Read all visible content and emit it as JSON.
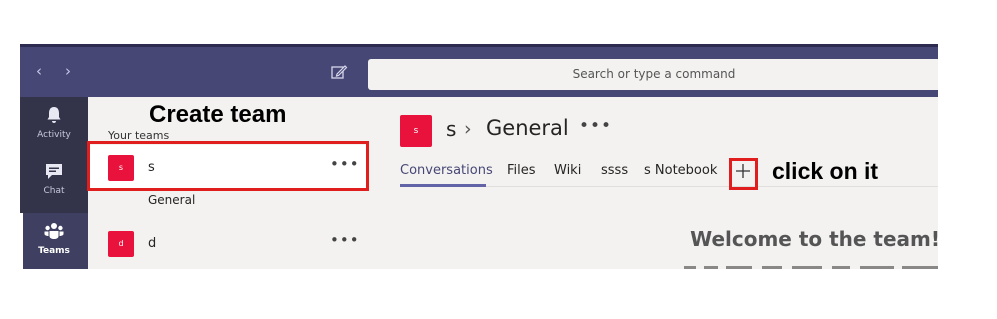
{
  "topbar": {
    "search_placeholder": "Search or type a command"
  },
  "rail": {
    "items": [
      {
        "label": "Activity",
        "icon": "bell-icon"
      },
      {
        "label": "Chat",
        "icon": "chat-icon"
      },
      {
        "label": "Teams",
        "icon": "teams-icon"
      }
    ],
    "active": "Teams"
  },
  "teams": {
    "heading": "Your teams",
    "list": [
      {
        "avatar": "s",
        "name": "s",
        "channels": [
          "General"
        ]
      },
      {
        "avatar": "d",
        "name": "d"
      }
    ]
  },
  "main": {
    "team_avatar": "s",
    "team_name": "s",
    "channel": "General",
    "tabs": [
      "Conversations",
      "Files",
      "Wiki",
      "ssss",
      "s Notebook"
    ],
    "active_tab": "Conversations",
    "welcome": "Welcome to the team!"
  },
  "annotations": {
    "create_team": "Create team",
    "click_on_it": "click on it",
    "color": "#e01e1e"
  },
  "colors": {
    "header": "#464775",
    "rail": "#33344a",
    "accent": "#6264a7",
    "avatar": "#e8123c"
  }
}
